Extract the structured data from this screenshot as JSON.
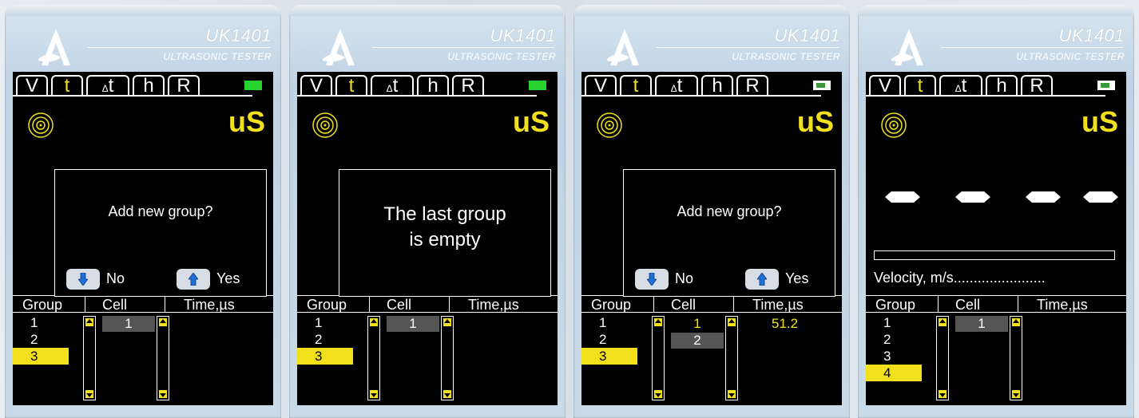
{
  "device": {
    "brand": "UK1401",
    "subtitle": "ULTRASONIC TESTER"
  },
  "tabs": [
    "V",
    "t",
    "t",
    "h",
    "R"
  ],
  "tab_delta_symbol": "Δ",
  "unit": "uS",
  "dialog": {
    "question": "Add new group?",
    "no_label": "No",
    "yes_label": "Yes"
  },
  "message": {
    "line1": "The last group",
    "line2": "is empty"
  },
  "velocity_label": "Velocity, m/s.......................",
  "table": {
    "headers": [
      "Group",
      "Cell",
      "Time,µs"
    ]
  },
  "panels": [
    {
      "groups": [
        "1",
        "2",
        "3"
      ],
      "selected_group": "3",
      "cells": [
        "1"
      ],
      "selected_cell": "1",
      "times": [],
      "battery": "full",
      "overlay": "dialog"
    },
    {
      "groups": [
        "1",
        "2",
        "3"
      ],
      "selected_group": "3",
      "cells": [
        "1"
      ],
      "selected_cell": "1",
      "times": [],
      "battery": "full",
      "overlay": "message"
    },
    {
      "groups": [
        "1",
        "2",
        "3"
      ],
      "selected_group": "3",
      "cells": [
        "1",
        "2"
      ],
      "selected_cell": "2",
      "times": [
        "51.2"
      ],
      "battery": "charging",
      "overlay": "dialog"
    },
    {
      "groups": [
        "1",
        "2",
        "3",
        "4"
      ],
      "selected_group": "4",
      "cells": [
        "1"
      ],
      "selected_cell": "1",
      "times": [],
      "battery": "charging",
      "overlay": "none"
    }
  ],
  "colors": {
    "accent": "#f2e01c",
    "screen": "#000000",
    "battery_full": "#29d32f"
  }
}
